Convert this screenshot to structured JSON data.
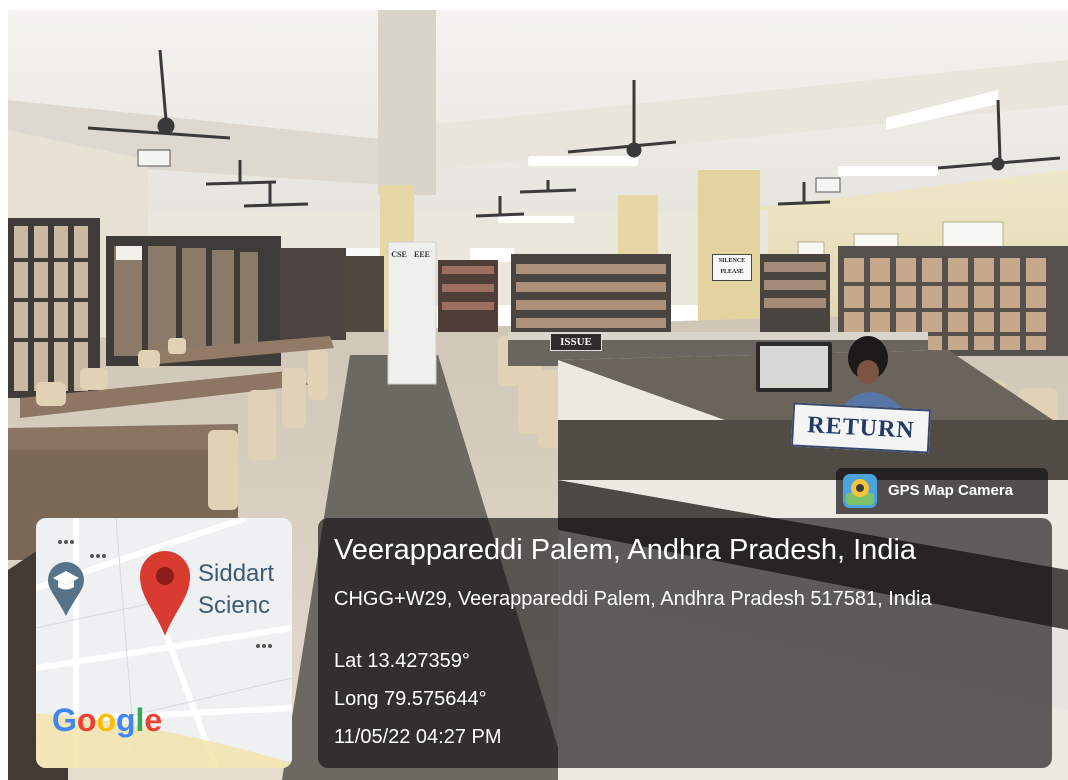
{
  "signs": {
    "issue": "ISSUE",
    "return": "RETURN",
    "cse": "CSE",
    "eee": "EEE",
    "silence_line1": "SILENCE",
    "silence_line2": "PLEASE"
  },
  "gps_badge": {
    "app_name": "GPS Map Camera",
    "icon": "gps-map-camera-icon"
  },
  "location": {
    "title": "Veerappareddi Palem, Andhra Pradesh, India",
    "address": "CHGG+W29, Veerappareddi Palem, Andhra Pradesh 517581, India",
    "latitude": "Lat 13.427359°",
    "longitude": "Long 79.575644°",
    "datetime": "11/05/22 04:27 PM"
  },
  "map": {
    "place_line1": "Siddart",
    "place_line2": "Scienc",
    "provider": "Google",
    "pin_color": "#d93b30",
    "education_icon": "graduation-cap-icon"
  },
  "colors": {
    "overlay": "#141414",
    "shelf": "#3f3b38",
    "floor": "#d9cdbb",
    "desk": "#ece8e2"
  }
}
